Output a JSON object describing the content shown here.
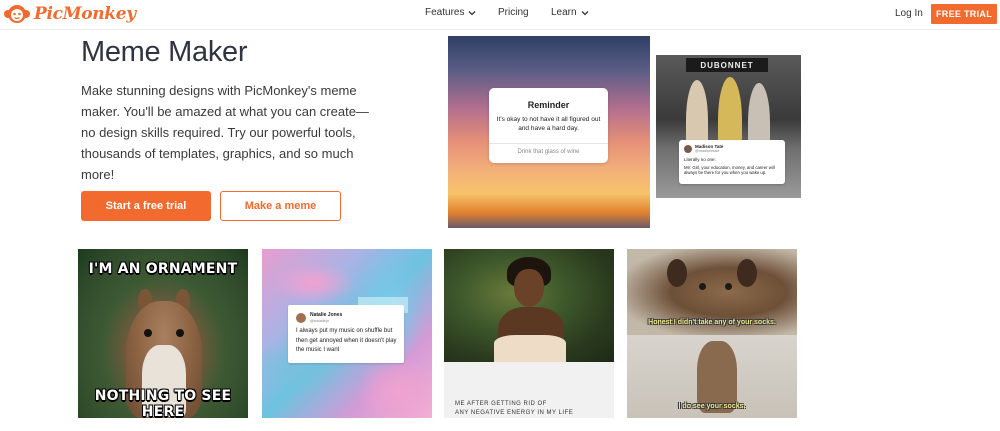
{
  "header": {
    "brand": "PicMonkey",
    "nav": [
      {
        "label": "Features",
        "has_dropdown": true
      },
      {
        "label": "Pricing",
        "has_dropdown": false
      },
      {
        "label": "Learn",
        "has_dropdown": true
      }
    ],
    "login_label": "Log In",
    "cta_label": "FREE TRIAL"
  },
  "hero": {
    "title": "Meme Maker",
    "description": "Make stunning designs with PicMonkey's meme maker. You'll be amazed at what you can create—no design skills required. Try our powerful tools, thousands of templates, graphics, and so much more!",
    "primary_button": "Start a free trial",
    "secondary_button": "Make a meme"
  },
  "tiles": {
    "sky": {
      "card_title": "Reminder",
      "card_body": "It's okay to not have it all figured out and have a hard day.",
      "card_footer": "Drink that glass of wine"
    },
    "street": {
      "sign": "DUBONNET",
      "tweet_name": "Madison Tate",
      "tweet_handle": "@madisontate",
      "tweet_line1": "Literally no one:",
      "tweet_line2": "Me: Girl, your education, money, and career will always be there for you when you wake up."
    },
    "squirrel": {
      "top_text": "I'M AN ORNAMENT",
      "bottom_text": "NOTHING TO SEE HERE"
    },
    "marble": {
      "tweet_name": "Natalie Jones",
      "tweet_handle": "@nataliejo",
      "tweet_body": "I always put my music on shuffle but then get annoyed when it doesn't play the music I want"
    },
    "woman": {
      "caption_line1": "ME AFTER GETTING RID OF",
      "caption_line2": "ANY NEGATIVE ENERGY IN MY LIFE"
    },
    "dogs": {
      "top_text": "Honest I didn't take any of your socks.",
      "bottom_text": "I do see your socks."
    }
  },
  "colors": {
    "brand": "#f26a2e",
    "text": "#2e3440"
  }
}
